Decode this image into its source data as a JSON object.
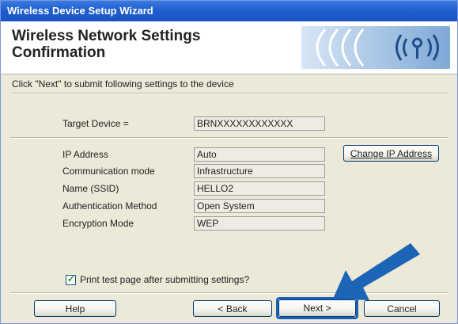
{
  "window": {
    "title": "Wireless Device Setup Wizard"
  },
  "header": {
    "title": "Wireless Network Settings Confirmation"
  },
  "instruction": "Click \"Next\" to submit following settings to the device",
  "target": {
    "label": "Target Device =",
    "value": "BRNXXXXXXXXXXXX"
  },
  "settings": [
    {
      "label": "IP Address",
      "value": "Auto"
    },
    {
      "label": "Communication mode",
      "value": "Infrastructure"
    },
    {
      "label": "Name (SSID)",
      "value": "HELLO2"
    },
    {
      "label": "Authentication Method",
      "value": "Open System"
    },
    {
      "label": "Encryption Mode",
      "value": "WEP"
    }
  ],
  "change_ip_button": "Change IP Address",
  "print_test": {
    "label": "Print test page after submitting settings?",
    "checked": true
  },
  "buttons": {
    "help": "Help",
    "back": "< Back",
    "next": "Next >",
    "cancel": "Cancel"
  },
  "icons": {
    "logo": "wireless-signal-logo",
    "pointer": "blue-arrow-icon"
  },
  "colors": {
    "title_bar": "#1F5FD0",
    "accent": "#1A62B8",
    "arrow": "#1B64B6"
  }
}
